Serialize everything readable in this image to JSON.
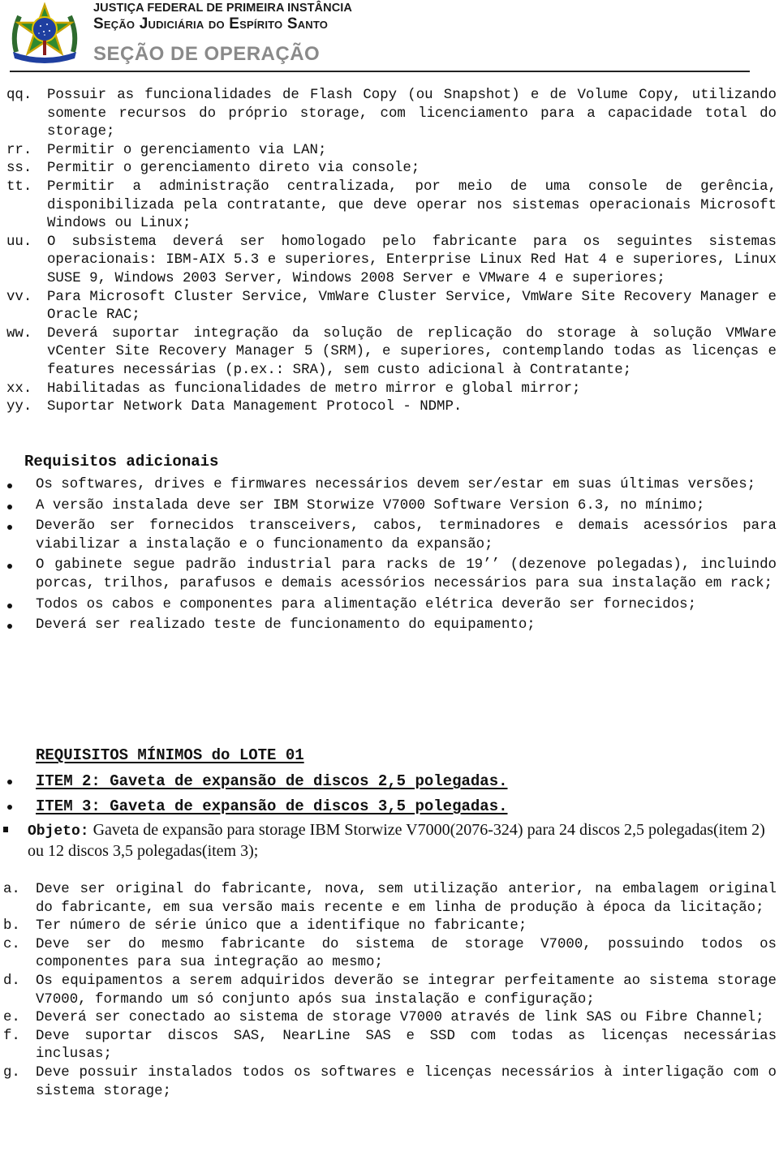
{
  "header": {
    "logo_icon": "brazil-coat-of-arms-icon",
    "line1": "JUSTIÇA FEDERAL DE PRIMEIRA INSTÂNCIA",
    "line2": "Seção Judiciária do Espírito Santo",
    "line3": "SEÇÃO DE OPERAÇÃO"
  },
  "requirements_continued": [
    {
      "marker": "qq.",
      "text": "Possuir as funcionalidades de Flash Copy (ou Snapshot) e de Volume Copy, utilizando somente recursos do próprio storage, com licenciamento para a capacidade total do storage;"
    },
    {
      "marker": "rr.",
      "text": "Permitir o gerenciamento via LAN;"
    },
    {
      "marker": "ss.",
      "text": "Permitir o gerenciamento direto via console;"
    },
    {
      "marker": "tt.",
      "text": "Permitir a administração centralizada, por meio de uma console de gerência, disponibilizada pela contratante, que deve operar nos sistemas operacionais Microsoft Windows ou Linux;"
    },
    {
      "marker": "uu.",
      "text": "O subsistema deverá ser homologado pelo fabricante para os seguintes sistemas operacionais: IBM-AIX 5.3 e superiores, Enterprise Linux Red Hat 4 e superiores, Linux SUSE 9, Windows 2003 Server, Windows 2008 Server e VMware 4 e superiores;"
    },
    {
      "marker": "vv.",
      "text": "Para Microsoft Cluster Service, VmWare Cluster Service, VmWare Site Recovery Manager e Oracle RAC;"
    },
    {
      "marker": "ww.",
      "text": "Deverá suportar integração da solução de replicação do storage à solução VMWare vCenter Site Recovery Manager 5 (SRM), e superiores, contemplando todas as licenças e features necessárias (p.ex.: SRA), sem custo adicional à Contratante;"
    },
    {
      "marker": "xx.",
      "text": "Habilitadas as funcionalidades de metro mirror e global mirror;"
    },
    {
      "marker": "yy.",
      "text": "Suportar Network Data Management Protocol - NDMP."
    }
  ],
  "additional": {
    "title": "Requisitos adicionais",
    "items": [
      "Os softwares, drives e firmwares necessários devem ser/estar em suas últimas versões;",
      "A versão instalada deve ser IBM Storwize V7000 Software Version 6.3, no mínimo;",
      "Deverão ser fornecidos transceivers, cabos, terminadores e demais acessórios para viabilizar a instalação e o funcionamento da expansão;",
      "O gabinete segue padrão industrial para racks de 19’’ (dezenove polegadas), incluindo porcas, trilhos, parafusos e demais acessórios necessários para sua instalação em rack;",
      "Todos os cabos e componentes para alimentação elétrica deverão ser fornecidos;",
      "Deverá ser realizado teste de funcionamento do equipamento;"
    ]
  },
  "lote": {
    "title": "REQUISITOS MÍNIMOS do LOTE 01",
    "items": [
      "ITEM 2: Gaveta de expansão de discos 2,5 polegadas.",
      "ITEM 3: Gaveta de expansão de discos 3,5 polegadas."
    ],
    "objeto_label": "Objeto:",
    "objeto_text": "Gaveta de expansão para storage IBM Storwize V7000(2076-324) para 24 discos 2,5 polegadas(item 2) ou 12 discos 3,5 polegadas(item 3);"
  },
  "lote_requirements": [
    {
      "marker": "a.",
      "text": "Deve ser original do fabricante, nova, sem utilização anterior, na embalagem original do fabricante, em sua versão mais recente e em linha de produção à época da licitação;"
    },
    {
      "marker": "b.",
      "text": "Ter número de série único que a identifique no fabricante;"
    },
    {
      "marker": "c.",
      "text": "Deve ser do mesmo fabricante do sistema de storage V7000, possuindo todos os componentes para sua integração ao mesmo;"
    },
    {
      "marker": "d.",
      "text": "Os equipamentos a serem adquiridos deverão se integrar perfeitamente ao sistema storage V7000, formando um só conjunto após sua instalação e configuração;"
    },
    {
      "marker": "e.",
      "text": "Deverá ser conectado ao sistema de storage V7000 através de link SAS ou Fibre Channel;"
    },
    {
      "marker": "f.",
      "text": "Deve suportar discos SAS, NearLine SAS e SSD com todas as licenças necessárias inclusas;"
    },
    {
      "marker": "g.",
      "text": "Deve possuir instalados todos os softwares e licenças necessários à interligação com o sistema storage;"
    }
  ]
}
